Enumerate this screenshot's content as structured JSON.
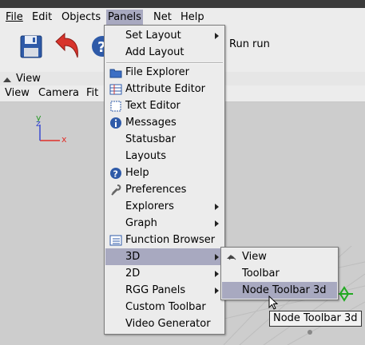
{
  "menubar": {
    "file": "File",
    "edit": "Edit",
    "objects": "Objects",
    "panels": "Panels",
    "net": "Net",
    "help": "Help"
  },
  "toolbar": {
    "run_label": "Run run"
  },
  "view_panel": {
    "title": "View",
    "menu": [
      "View",
      "Camera",
      "Fit"
    ],
    "axes": {
      "y": "y",
      "z": "z",
      "x": "x"
    },
    "axis_colors": {
      "x": "#e0302a",
      "y": "#2a9a2a",
      "z": "#3a4ad0"
    }
  },
  "panels_menu": {
    "set_layout": "Set Layout",
    "add_layout": "Add Layout",
    "file_explorer": "File Explorer",
    "attribute_editor": "Attribute Editor",
    "text_editor": "Text Editor",
    "messages": "Messages",
    "statusbar": "Statusbar",
    "layouts": "Layouts",
    "help": "Help",
    "preferences": "Preferences",
    "explorers": "Explorers",
    "graph": "Graph",
    "function_browser": "Function Browser",
    "three_d": "3D",
    "two_d": "2D",
    "rgg_panels": "RGG Panels",
    "custom_toolbar": "Custom Toolbar",
    "video_generator": "Video Generator"
  },
  "submenu_3d": {
    "view": "View",
    "toolbar": "Toolbar",
    "node_toolbar": "Node Toolbar 3d"
  },
  "tooltip": "Node Toolbar 3d",
  "colors": {
    "highlight": "#a8a9c0",
    "menu_bg": "#ececec"
  }
}
